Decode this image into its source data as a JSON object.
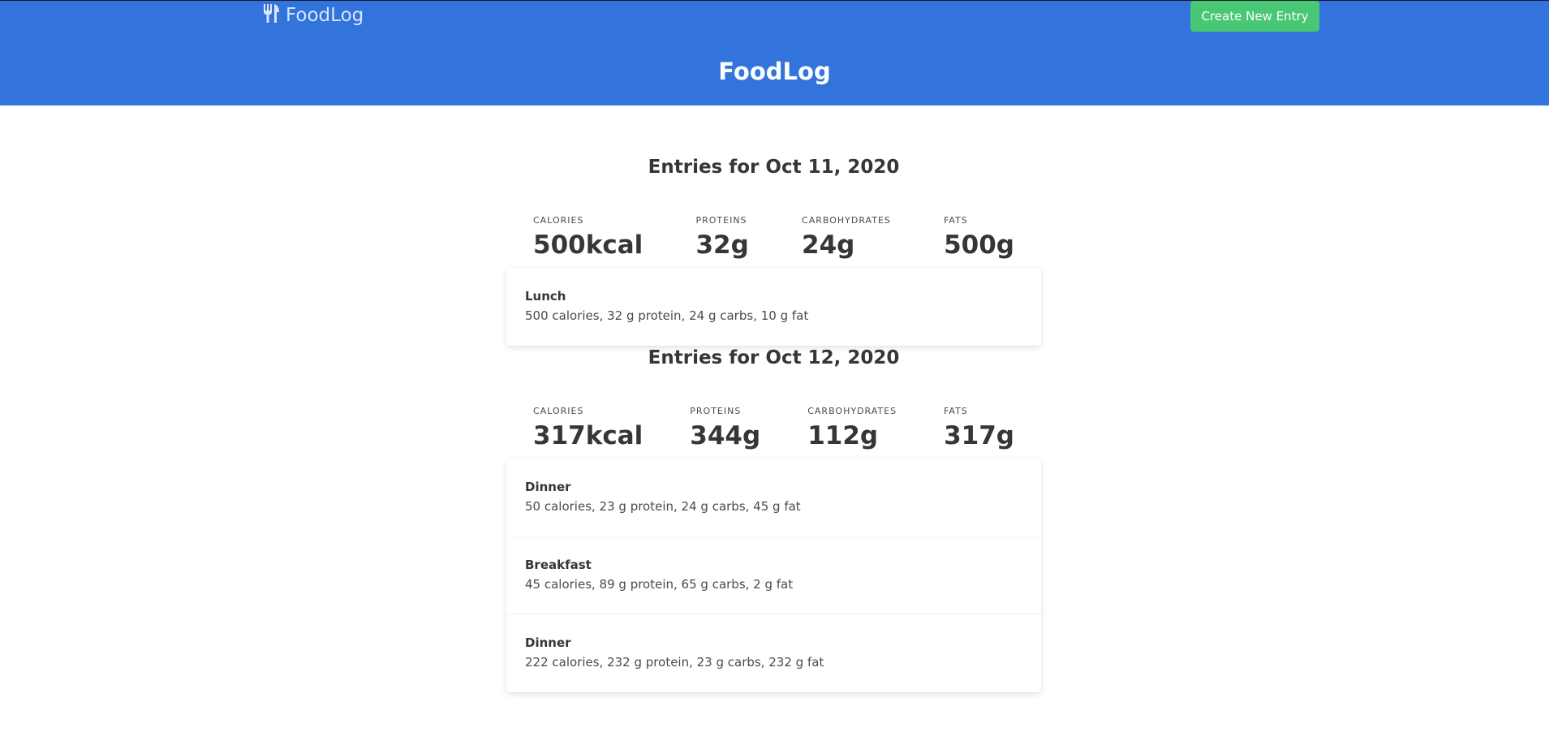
{
  "navbar": {
    "brand_label": "FoodLog",
    "brand_icon": "utensils-icon",
    "create_button_label": "Create New Entry"
  },
  "hero": {
    "title": "FoodLog"
  },
  "colors": {
    "primary": "#3273dc",
    "success": "#48c774",
    "text": "#363636"
  },
  "days": [
    {
      "title": "Entries for Oct 11, 2020",
      "stats": {
        "calories_label": "CALORIES",
        "calories": "500kcal",
        "proteins_label": "PROTEINS",
        "proteins": "32g",
        "carbs_label": "CARBOHYDRATES",
        "carbs": "24g",
        "fats_label": "FATS",
        "fats": "500g"
      },
      "entries": [
        {
          "name": "Lunch",
          "detail": "500 calories, 32 g protein, 24 g carbs, 10 g fat"
        }
      ]
    },
    {
      "title": "Entries for Oct 12, 2020",
      "stats": {
        "calories_label": "CALORIES",
        "calories": "317kcal",
        "proteins_label": "PROTEINS",
        "proteins": "344g",
        "carbs_label": "CARBOHYDRATES",
        "carbs": "112g",
        "fats_label": "FATS",
        "fats": "317g"
      },
      "entries": [
        {
          "name": "Dinner",
          "detail": "50 calories, 23 g protein, 24 g carbs, 45 g fat"
        },
        {
          "name": "Breakfast",
          "detail": "45 calories, 89 g protein, 65 g carbs, 2 g fat"
        },
        {
          "name": "Dinner",
          "detail": "222 calories, 232 g protein, 23 g carbs, 232 g fat"
        }
      ]
    }
  ]
}
